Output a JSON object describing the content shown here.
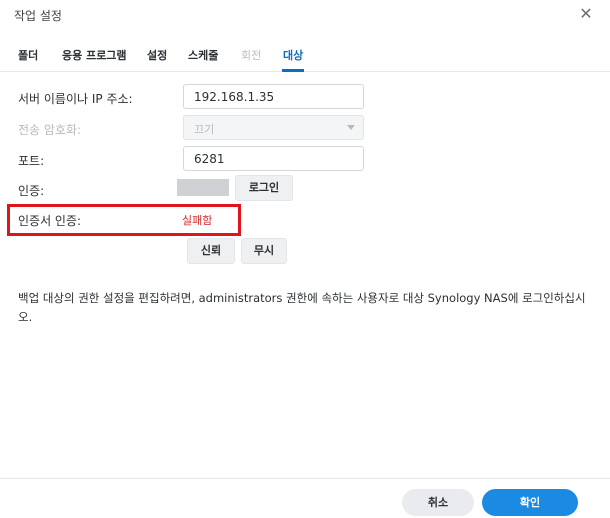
{
  "dialog": {
    "title": "작업 설정"
  },
  "tabs": [
    {
      "label": "폴더"
    },
    {
      "label": "응용 프로그램"
    },
    {
      "label": "설정"
    },
    {
      "label": "스케줄"
    },
    {
      "label": "회전"
    },
    {
      "label": "대상"
    }
  ],
  "form": {
    "server_label": "서버 이름이나 IP 주소:",
    "server_value": "192.168.1.35",
    "encryption_label": "전송 암호화:",
    "encryption_value": "끄기",
    "port_label": "포트:",
    "port_value": "6281",
    "auth_label": "인증:",
    "login_button": "로그인",
    "cert_label": "인증서 인증:",
    "cert_status": "실패함",
    "trust_button": "신뢰",
    "ignore_button": "무시"
  },
  "note": "백업 대상의 권한 설정을 편집하려면, administrators 권한에 속하는 사용자로 대상 Synology NAS에 로그인하십시오.",
  "footer": {
    "cancel": "취소",
    "ok": "확인"
  },
  "colors": {
    "accent": "#0a6fc2",
    "primary_button": "#1a8ae3",
    "error": "#d12a2a",
    "highlight": "#e0141b"
  }
}
